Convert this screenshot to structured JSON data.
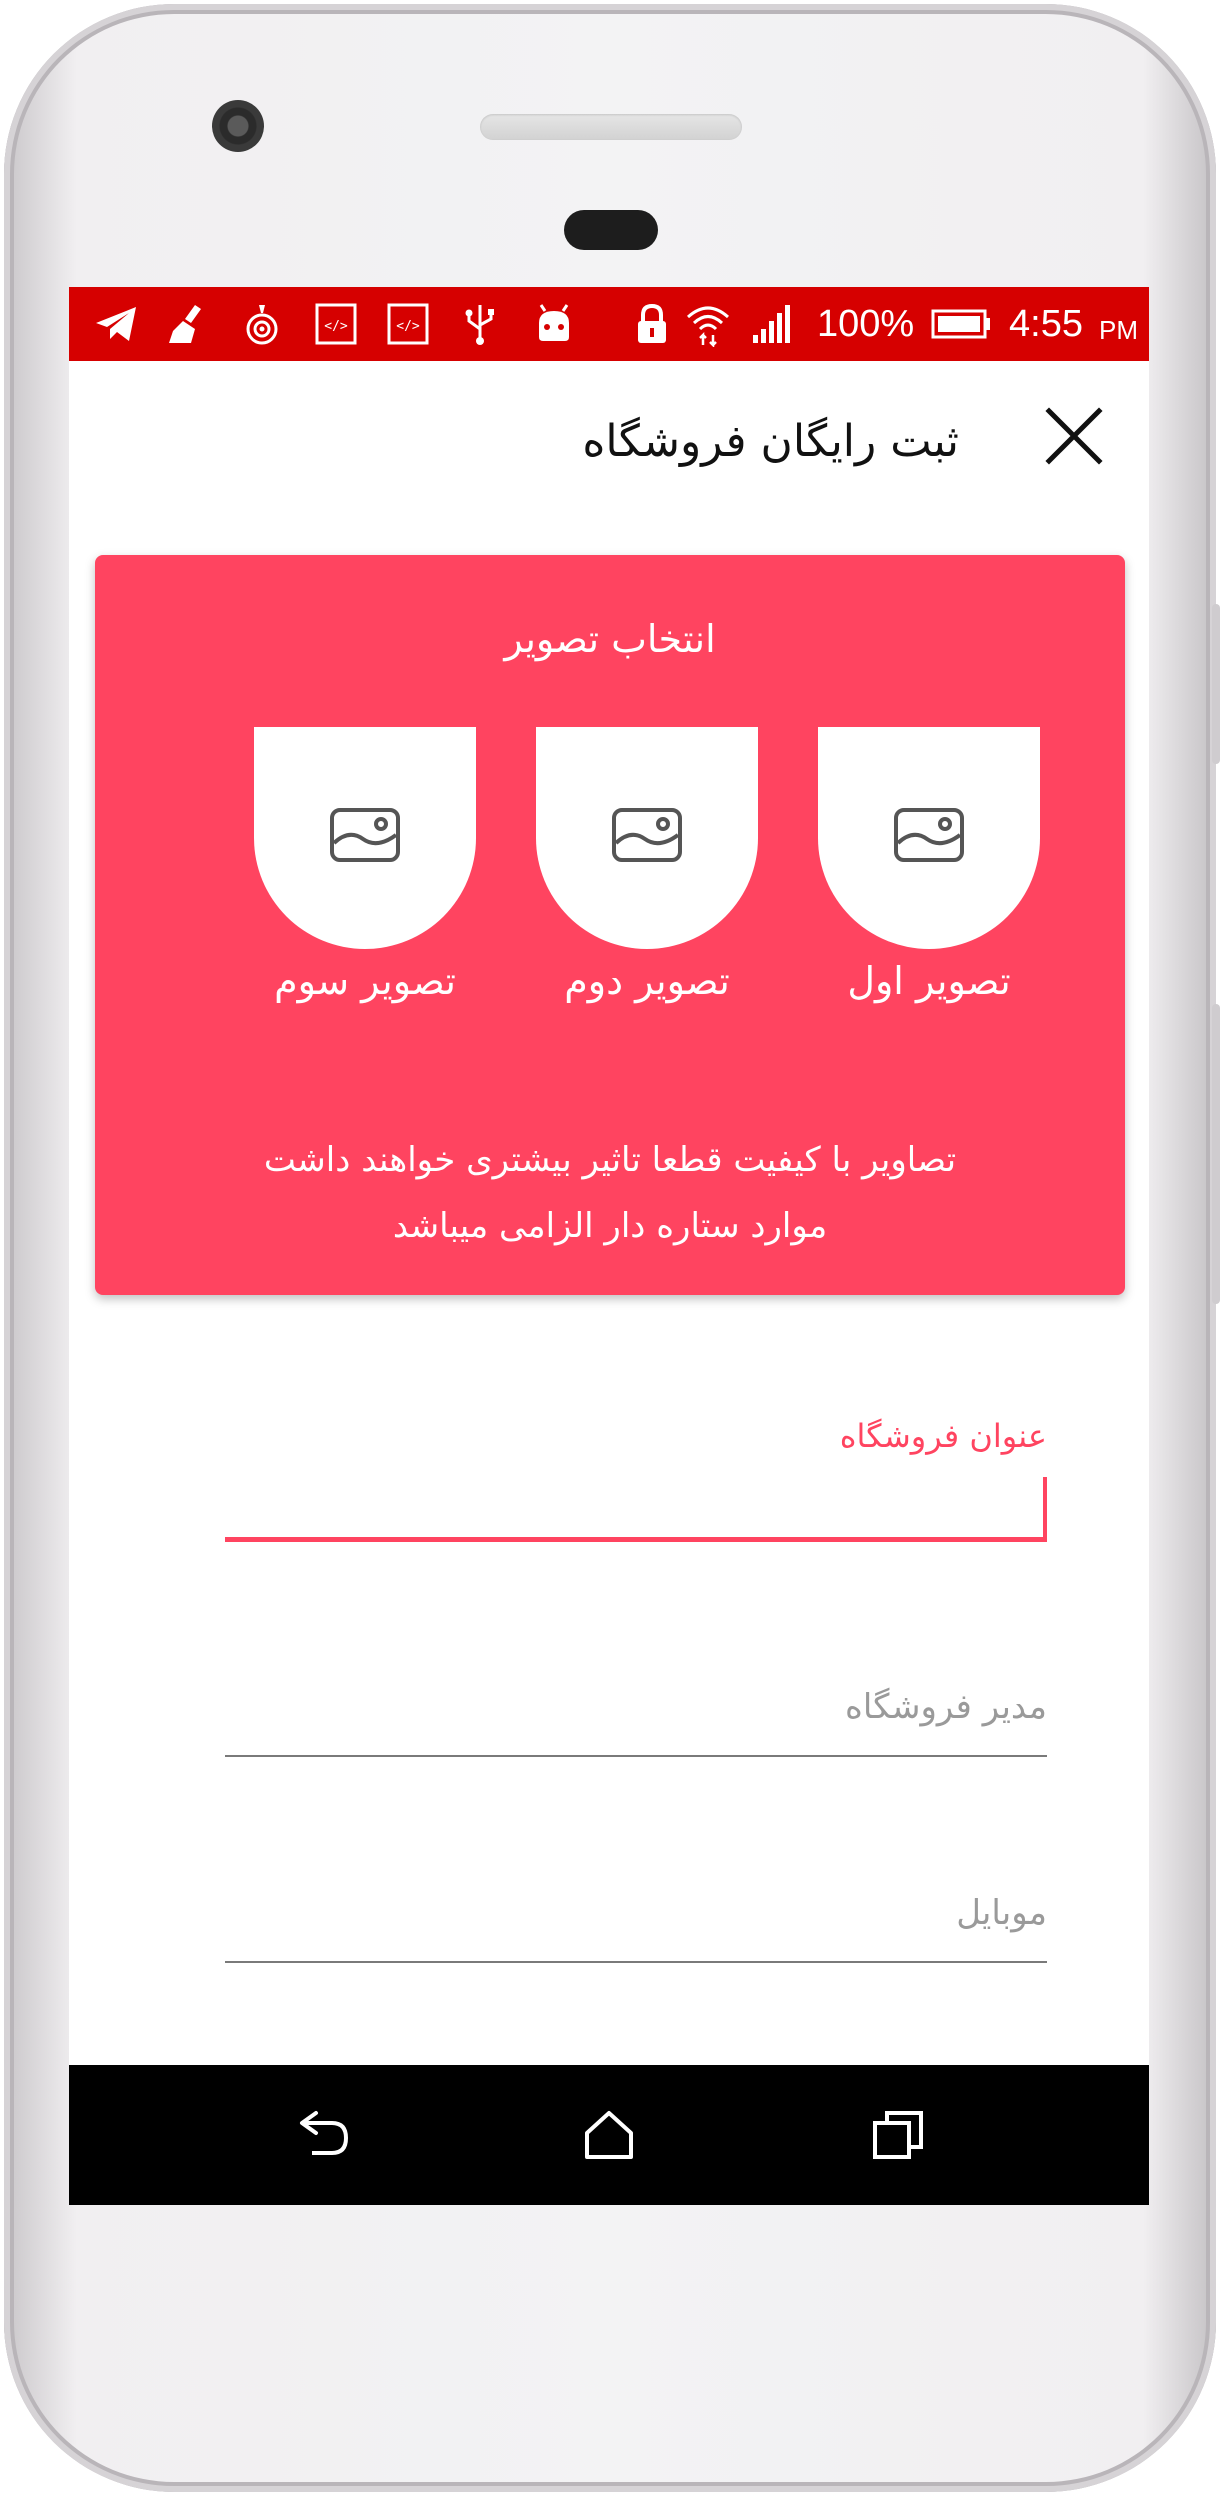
{
  "status_bar": {
    "battery": "100%",
    "time": "4:55",
    "ampm": "PM",
    "background": "#d60000",
    "icons": [
      "telegram-icon",
      "cleaner-icon",
      "hotspot-icon",
      "code-icon",
      "code-icon",
      "usb-icon",
      "android-icon",
      "lock-icon",
      "wifi-icon",
      "signal-icon",
      "battery-icon"
    ]
  },
  "app_bar": {
    "title": "ثبت رایگان فروشگاه",
    "close_icon": "close-icon"
  },
  "image_card": {
    "title": "انتخاب تصویر",
    "accent": "#ff4460",
    "slots": [
      {
        "label": "تصویر اول",
        "icon": "image-icon"
      },
      {
        "label": "تصویر دوم",
        "icon": "image-icon"
      },
      {
        "label": "تصویر سوم",
        "icon": "image-icon"
      }
    ],
    "note_line1": "تصاویر با کیفیت قطعا تاثیر بیشتری خواهند داشت",
    "note_line2": "موارد ستاره دار الزامی میباشد"
  },
  "form": {
    "store_title_label": "عنوان فروشگاه",
    "store_title_value": "",
    "manager_placeholder": "مدیر فروشگاه",
    "mobile_placeholder": "موبایل"
  },
  "nav_bar": {
    "icons": [
      "back-icon",
      "home-icon",
      "recents-icon"
    ]
  }
}
